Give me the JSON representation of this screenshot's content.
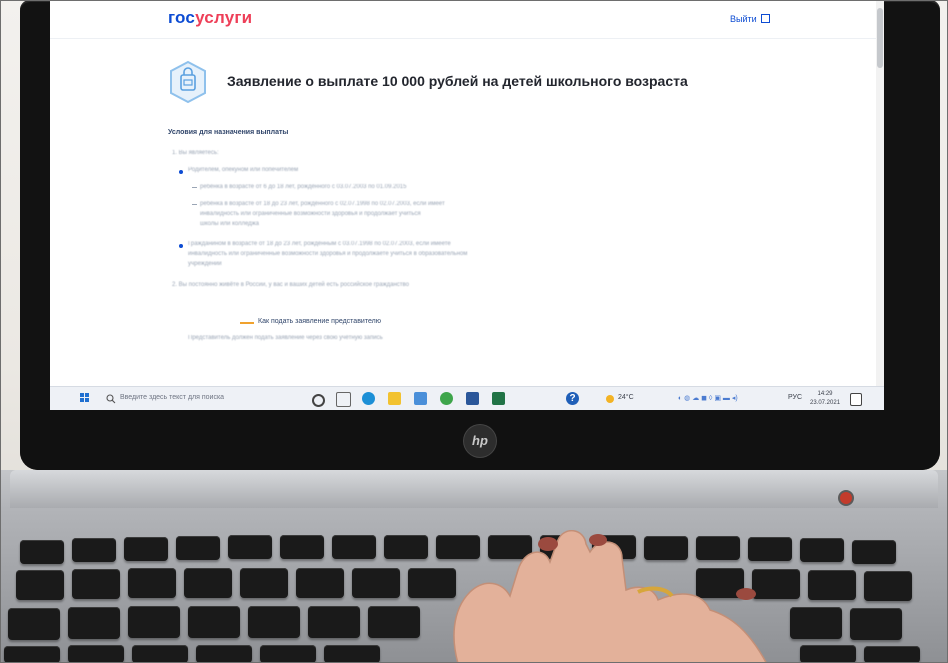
{
  "screen": {
    "logo": {
      "part1": "гос",
      "part2": "услуги"
    },
    "logout_label": "Выйти",
    "title": "Заявление о выплате 10 000 рублей на детей школьного возраста",
    "section_heading": "Условия для назначения выплаты",
    "blurred_lines": [
      "1. Вы являетесь:",
      "Родителем, опекуном или попечителем",
      "ребёнка в возрасте от 6 до 18 лет, рождённого с 03.07.2003 по 01.09.2015",
      "ребёнка в возрасте от 18 до 23 лет, рождённого с 02.07.1998 по 02.07.2003, если имеет",
      "инвалидность или ограниченные возможности здоровья и продолжает учиться",
      "школы или колледжа",
      "Гражданином в возрасте от 18 до 23 лет, рождённым с 03.07.1998 по 02.07.2003, если имеете",
      "инвалидность или ограниченные возможности здоровья и продолжаете учиться в образовательном",
      "учреждении",
      "2. Вы постоянно живёте в России, у вас и ваших детей есть российское гражданство"
    ],
    "accordion_label": "Как подать заявление представителю",
    "accordion_sub": "Представитель должен подать заявление через свою учётную запись",
    "colors": {
      "brand_blue": "#0d4cd3",
      "brand_red": "#ee3f58",
      "accent_orange": "#f0a22e"
    }
  },
  "taskbar": {
    "search_placeholder": "Введите здесь текст для поиска",
    "weather": "24°C",
    "lang": "РУС",
    "time": "14:29",
    "date": "23.07.2021"
  },
  "laptop": {
    "brand_logo": "hp"
  }
}
